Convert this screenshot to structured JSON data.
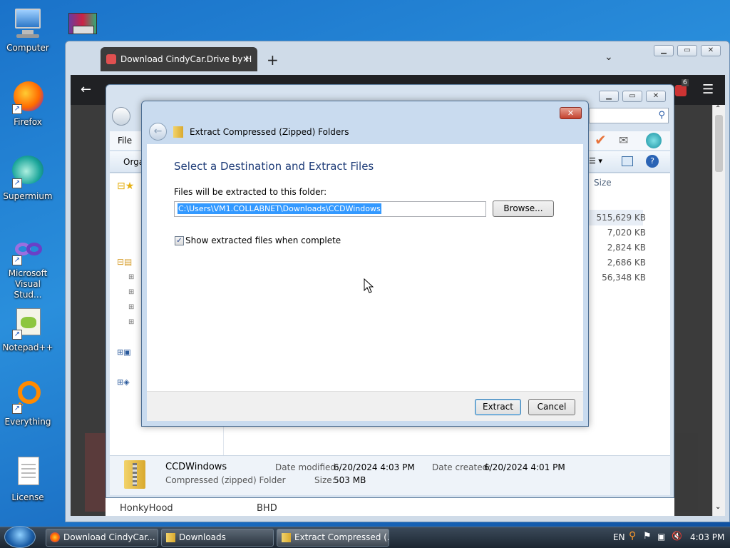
{
  "desktop": {
    "icons": [
      {
        "label": "Computer"
      },
      {
        "label": "Firefox"
      },
      {
        "label": "Supermium"
      },
      {
        "label": "Microsoft Visual Stud..."
      },
      {
        "label": "Notepad++"
      },
      {
        "label": "Everything"
      },
      {
        "label": "License"
      }
    ]
  },
  "browser": {
    "tab_title": "Download CindyCar.Drive by H",
    "new_tab": "+",
    "badge_count": "6",
    "bottom_left": "HonkyHood",
    "bottom_mid": "BHD"
  },
  "explorer": {
    "menu_file": "File",
    "toolbar_organize": "Orga",
    "column_size": "Size",
    "sizes": [
      "515,629 KB",
      "7,020 KB",
      "2,824 KB",
      "2,686 KB",
      "56,348 KB"
    ],
    "details": {
      "name": "CCDWindows",
      "type": "Compressed (zipped) Folder",
      "date_modified_label": "Date modified:",
      "date_modified": "6/20/2024 4:03 PM",
      "size_label": "Size:",
      "size": "503 MB",
      "date_created_label": "Date created:",
      "date_created": "6/20/2024 4:01 PM"
    }
  },
  "dialog": {
    "title": "Extract Compressed (Zipped) Folders",
    "heading": "Select a Destination and Extract Files",
    "path_label": "Files will be extracted to this folder:",
    "path_value": "C:\\Users\\VM1.COLLABNET\\Downloads\\CCDWindows",
    "browse": "Browse...",
    "show_files_label": "Show extracted files when complete",
    "show_files_checked": true,
    "extract": "Extract",
    "cancel": "Cancel"
  },
  "taskbar": {
    "items": [
      {
        "label": "Download CindyCar..."
      },
      {
        "label": "Downloads"
      },
      {
        "label": "Extract Compressed (..."
      }
    ],
    "language": "EN",
    "clock": "4:03 PM"
  }
}
